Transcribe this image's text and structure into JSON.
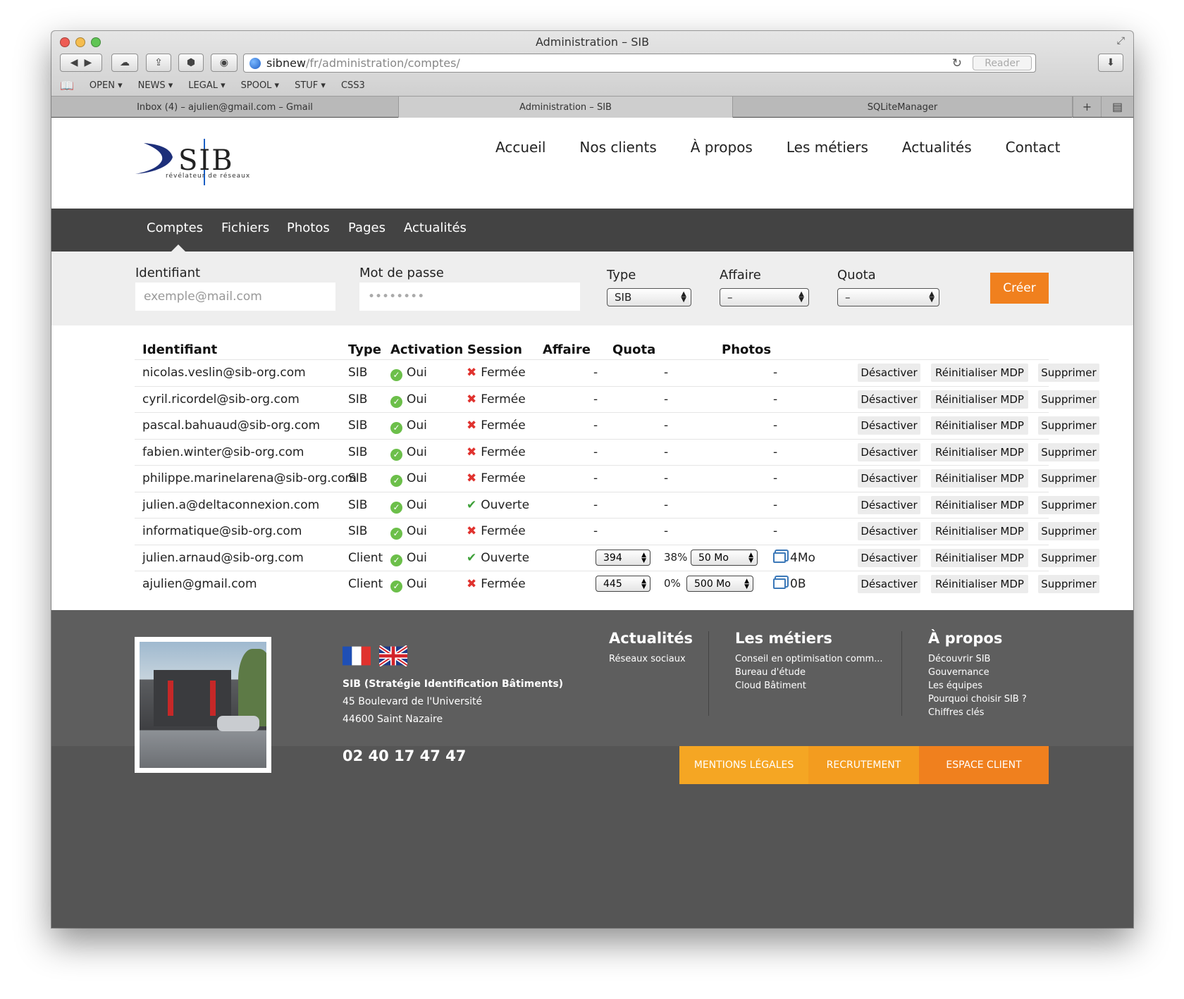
{
  "browser": {
    "window_title": "Administration – SIB",
    "url_host": "sibnew",
    "url_path": "/fr/administration/comptes/",
    "reader_label": "Reader",
    "bookmarks": [
      "OPEN ▾",
      "NEWS ▾",
      "LEGAL ▾",
      "SPOOL ▾",
      "STUF ▾",
      "CSS3"
    ],
    "tabs": [
      "Inbox (4) – ajulien@gmail.com – Gmail",
      "Administration – SIB",
      "SQLiteManager"
    ]
  },
  "site": {
    "logo_text": "SIB",
    "logo_tagline": "révélateur de réseaux",
    "nav": [
      "Accueil",
      "Nos clients",
      "À propos",
      "Les métiers",
      "Actualités",
      "Contact"
    ]
  },
  "admin_nav": [
    "Comptes",
    "Fichiers",
    "Photos",
    "Pages",
    "Actualités"
  ],
  "form": {
    "identifiant_label": "Identifiant",
    "identifiant_placeholder": "exemple@mail.com",
    "password_label": "Mot de passe",
    "password_value": "••••••••",
    "type_label": "Type",
    "type_value": "SIB",
    "affaire_label": "Affaire",
    "affaire_value": "–",
    "quota_label": "Quota",
    "quota_value": "–",
    "create_button": "Créer"
  },
  "table": {
    "headers": [
      "Identifiant",
      "Type",
      "Activation",
      "Session",
      "Affaire",
      "Quota",
      "Photos"
    ],
    "actions": [
      "Désactiver",
      "Réinitialiser MDP",
      "Supprimer"
    ],
    "rows": [
      {
        "id": "nicolas.veslin@sib-org.com",
        "type": "SIB",
        "activation": "Oui",
        "session": "Fermée",
        "session_open": false,
        "affaire": "-",
        "quota": "-",
        "photos": "-"
      },
      {
        "id": "cyril.ricordel@sib-org.com",
        "type": "SIB",
        "activation": "Oui",
        "session": "Fermée",
        "session_open": false,
        "affaire": "-",
        "quota": "-",
        "photos": "-"
      },
      {
        "id": "pascal.bahuaud@sib-org.com",
        "type": "SIB",
        "activation": "Oui",
        "session": "Fermée",
        "session_open": false,
        "affaire": "-",
        "quota": "-",
        "photos": "-"
      },
      {
        "id": "fabien.winter@sib-org.com",
        "type": "SIB",
        "activation": "Oui",
        "session": "Fermée",
        "session_open": false,
        "affaire": "-",
        "quota": "-",
        "photos": "-"
      },
      {
        "id": "philippe.marinelarena@sib-org.com",
        "type": "SIB",
        "activation": "Oui",
        "session": "Fermée",
        "session_open": false,
        "affaire": "-",
        "quota": "-",
        "photos": "-"
      },
      {
        "id": "julien.a@deltaconnexion.com",
        "type": "SIB",
        "activation": "Oui",
        "session": "Ouverte",
        "session_open": true,
        "affaire": "-",
        "quota": "-",
        "photos": "-"
      },
      {
        "id": "informatique@sib-org.com",
        "type": "SIB",
        "activation": "Oui",
        "session": "Fermée",
        "session_open": false,
        "affaire": "-",
        "quota": "-",
        "photos": "-"
      },
      {
        "id": "julien.arnaud@sib-org.com",
        "type": "Client",
        "activation": "Oui",
        "session": "Ouverte",
        "session_open": true,
        "affaire_select": "394",
        "quota_pct": "38%",
        "quota_select": "50 Mo",
        "photos_size": "4Mo"
      },
      {
        "id": "ajulien@gmail.com",
        "type": "Client",
        "activation": "Oui",
        "session": "Fermée",
        "session_open": false,
        "affaire_select": "445",
        "quota_pct": "0%",
        "quota_select": "500 Mo",
        "photos_size": "0B"
      }
    ]
  },
  "footer": {
    "company_name": "SIB (Stratégie Identification Bâtiments)",
    "address_line1": "45 Boulevard de l'Université",
    "address_line2": "44600 Saint Nazaire",
    "phone": "02 40 17 47 47",
    "columns": [
      {
        "title": "Actualités",
        "links": [
          "Réseaux sociaux"
        ]
      },
      {
        "title": "Les métiers",
        "links": [
          "Conseil en optimisation comm...",
          "Bureau d'étude",
          "Cloud Bâtiment"
        ]
      },
      {
        "title": "À propos",
        "links": [
          "Découvrir SIB",
          "Gouvernance",
          "Les équipes",
          "Pourquoi choisir SIB ?",
          "Chiffres clés"
        ]
      }
    ],
    "buttons": [
      "MENTIONS LÉGALES",
      "RECRUTEMENT",
      "ESPACE CLIENT"
    ],
    "colors": {
      "mentions": "#f5a623",
      "recrutement": "#f39c1f",
      "espace_client": "#f0801e"
    }
  }
}
